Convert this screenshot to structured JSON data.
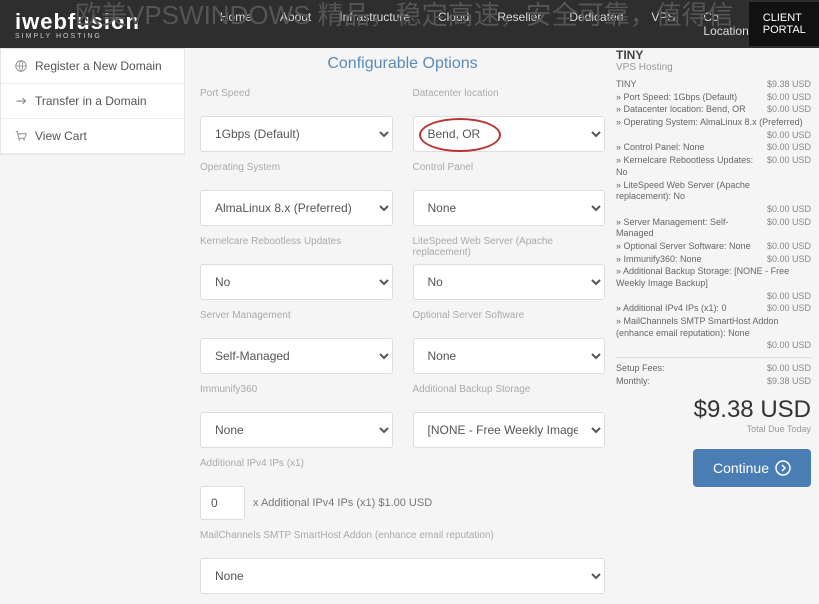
{
  "watermark": "欧美VPSWINDOWS 精品，稳定高速，安全可靠，值得信",
  "logo": {
    "main": "iwebfusion",
    "sub": "SIMPLY HOSTING"
  },
  "nav": {
    "items": [
      "Home",
      "About",
      "Infrastructure",
      "Cloud",
      "Reseller",
      "Dedicated",
      "VPS",
      "Co-Location"
    ],
    "portal": "CLIENT PORTAL"
  },
  "sidebar": {
    "register": "Register a New Domain",
    "transfer": "Transfer in a Domain",
    "cart": "View Cart"
  },
  "heading": "Configurable Options",
  "fields": {
    "port_speed": {
      "label": "Port Speed",
      "value": "1Gbps (Default)"
    },
    "datacenter": {
      "label": "Datacenter location",
      "value": "Bend, OR"
    },
    "os": {
      "label": "Operating System",
      "value": "AlmaLinux 8.x (Preferred)"
    },
    "control_panel": {
      "label": "Control Panel",
      "value": "None"
    },
    "kernelcare": {
      "label": "Kernelcare Rebootless Updates",
      "value": "No"
    },
    "litespeed": {
      "label": "LiteSpeed Web Server (Apache replacement)",
      "value": "No"
    },
    "server_mgmt": {
      "label": "Server Management",
      "value": "Self-Managed"
    },
    "opt_server": {
      "label": "Optional Server Software",
      "value": "None"
    },
    "immunify": {
      "label": "Immunify360",
      "value": "None"
    },
    "backup": {
      "label": "Additional Backup Storage",
      "value": "[NONE - Free Weekly Image"
    },
    "add_ipv4": {
      "label": "Additional IPv4 IPs (x1)",
      "value": "0",
      "suffix": "x Additional IPv4 IPs (x1) $1.00 USD"
    },
    "mailchannels": {
      "label": "MailChannels SMTP SmartHost Addon (enhance email reputation)",
      "value": "None"
    }
  },
  "summary": {
    "title": "TINY",
    "subtitle": "VPS Hosting",
    "lines": [
      {
        "l": "TINY",
        "r": "$9.38 USD"
      },
      {
        "l": "» Port Speed: 1Gbps (Default)",
        "r": "$0.00 USD"
      },
      {
        "l": "» Datacenter location: Bend, OR",
        "r": "$0.00 USD"
      },
      {
        "l": "» Operating System: AlmaLinux 8.x (Preferred)",
        "r": ""
      },
      {
        "l": "",
        "r": "$0.00 USD"
      },
      {
        "l": "» Control Panel: None",
        "r": "$0.00 USD"
      },
      {
        "l": "» Kernelcare Rebootless Updates: No",
        "r": "$0.00 USD"
      },
      {
        "l": "» LiteSpeed Web Server (Apache replacement): No",
        "r": ""
      },
      {
        "l": "",
        "r": "$0.00 USD"
      },
      {
        "l": "» Server Management: Self-Managed",
        "r": "$0.00 USD"
      },
      {
        "l": "» Optional Server Software: None",
        "r": "$0.00 USD"
      },
      {
        "l": "» Immunify360: None",
        "r": "$0.00 USD"
      },
      {
        "l": "» Additional Backup Storage: [NONE - Free Weekly Image Backup]",
        "r": ""
      },
      {
        "l": "",
        "r": "$0.00 USD"
      },
      {
        "l": "» Additional IPv4 IPs (x1): 0",
        "r": "$0.00 USD"
      },
      {
        "l": "» MailChannels SMTP SmartHost Addon (enhance email reputation): None",
        "r": ""
      },
      {
        "l": "",
        "r": "$0.00 USD"
      }
    ],
    "setup": {
      "l": "Setup Fees:",
      "r": "$0.00 USD"
    },
    "monthly": {
      "l": "Monthly:",
      "r": "$9.38 USD"
    },
    "total": "$9.38 USD",
    "total_sub": "Total Due Today",
    "continue": "Continue"
  }
}
